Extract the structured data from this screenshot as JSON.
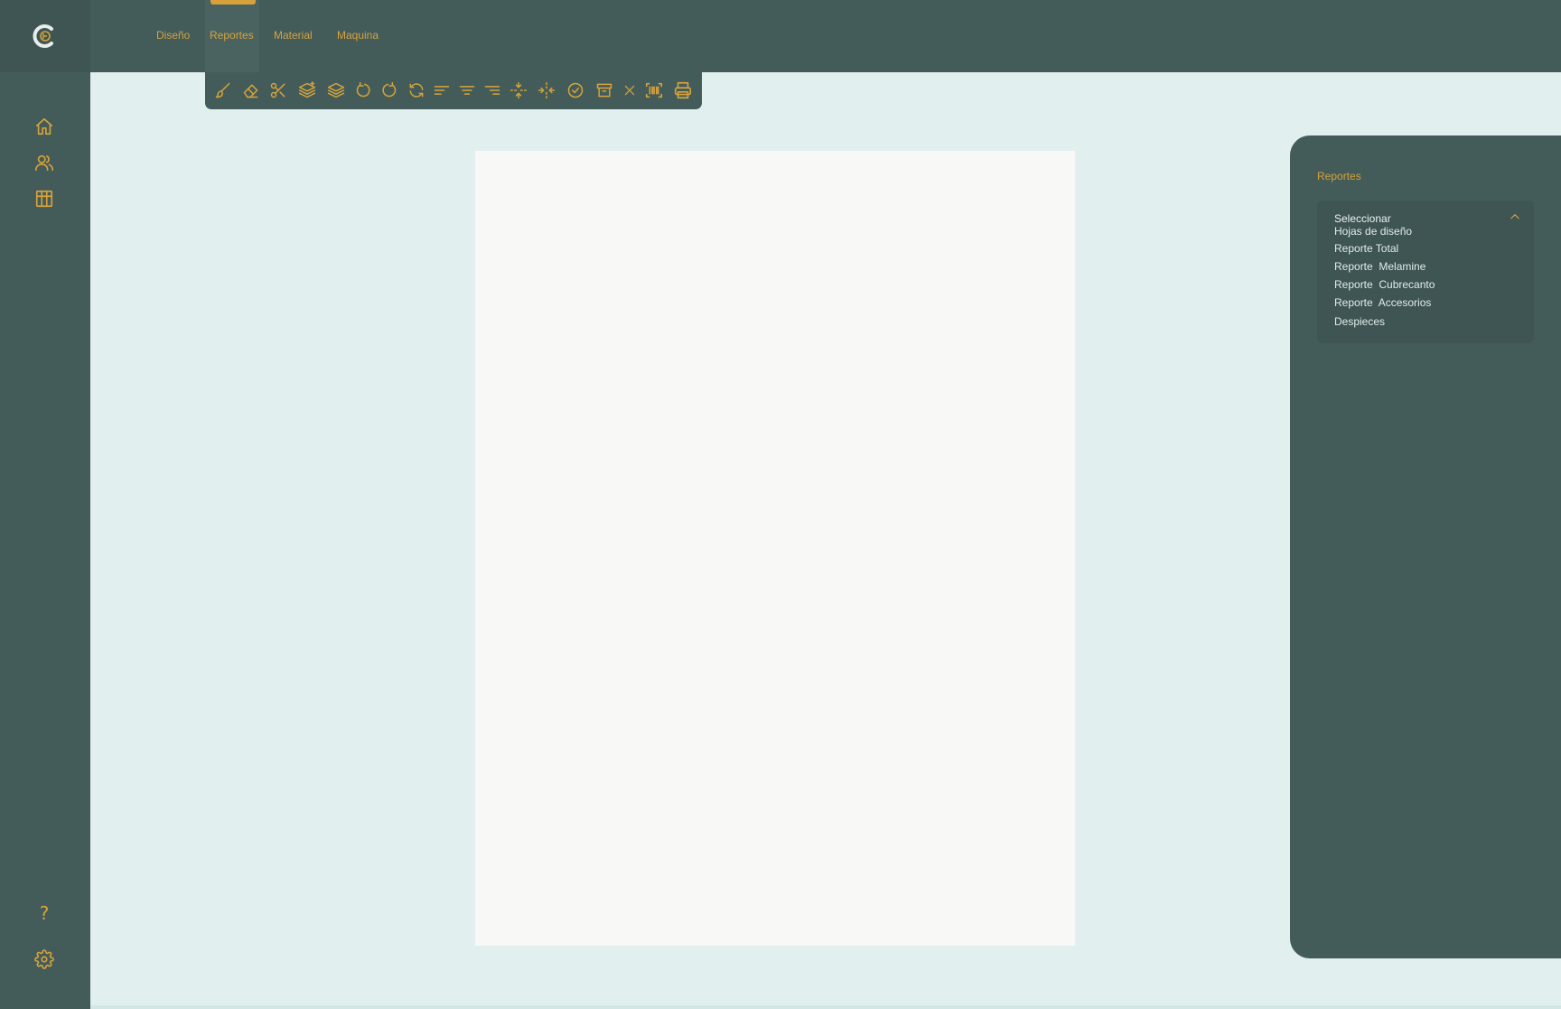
{
  "app": {
    "logo_icon": "c-logo-icon"
  },
  "sidebar": {
    "top_icons": [
      "home-icon",
      "users-icon",
      "store-icon"
    ],
    "bottom_icons": [
      "help-icon",
      "settings-icon"
    ],
    "help_glyph": "?"
  },
  "nav": {
    "items": [
      {
        "label": "Diseño"
      },
      {
        "label": "Reportes"
      },
      {
        "label": "Material"
      },
      {
        "label": "Maquina"
      }
    ],
    "active": "Reportes"
  },
  "toolbar": {
    "tools": [
      "brush-icon",
      "eraser-icon",
      "scissors-icon",
      "layer-add-icon",
      "layers-icon",
      "rotate-cw-icon",
      "rotate-ccw-icon",
      "refresh-icon",
      "align-left-icon",
      "align-center-icon",
      "align-right-icon",
      "split-vertical-icon",
      "split-horizontal-icon",
      "check-circle-icon",
      "archive-icon",
      "close-icon",
      "barcode-icon",
      "printer-icon"
    ]
  },
  "panel": {
    "title": "Reportes",
    "dropdown": {
      "selected": "Seleccionar",
      "options": [
        "Hojas de diseño",
        "Reporte Total",
        "Reporte  Melamine",
        "Reporte  Cubrecanto",
        "Reporte  Accesorios",
        "Despieces"
      ]
    }
  },
  "colors": {
    "accent": "#d7a23a",
    "sidebar": "#435c5a",
    "background": "#e1f0ef",
    "canvas": "#f8f8f7"
  }
}
